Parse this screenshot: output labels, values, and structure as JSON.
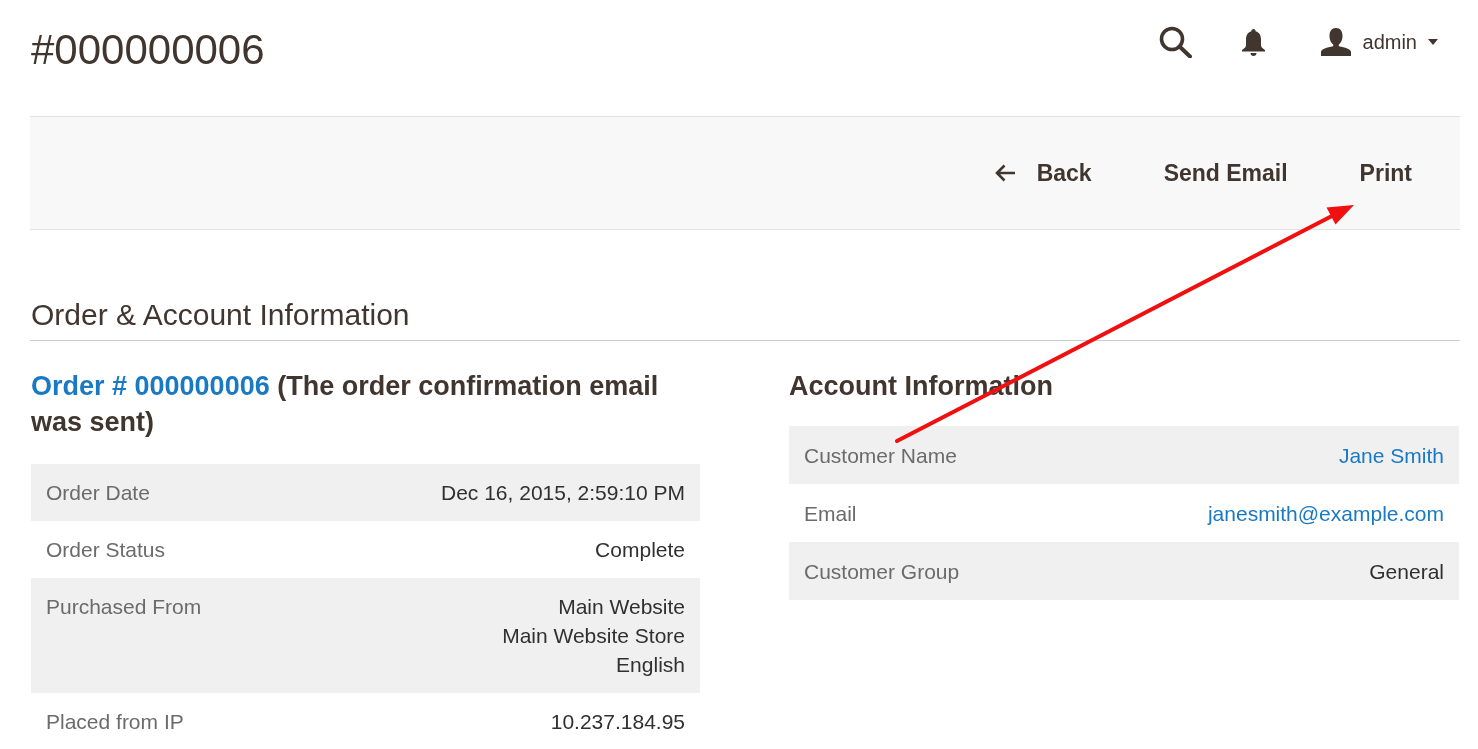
{
  "header": {
    "title": "#000000006",
    "user": "admin"
  },
  "actions": [
    {
      "label": "Back",
      "kind": "back"
    },
    {
      "label": "Send Email",
      "kind": "plain"
    },
    {
      "label": "Print",
      "kind": "plain"
    }
  ],
  "section_title": "Order & Account Information",
  "order": {
    "link": "Order # 000000006",
    "note": "(The order confirmation email was sent)",
    "rows": [
      {
        "label": "Order Date",
        "lines": [
          "Dec 16, 2015, 2:59:10 PM"
        ]
      },
      {
        "label": "Order Status",
        "lines": [
          "Complete"
        ]
      },
      {
        "label": "Purchased From",
        "lines": [
          "Main Website",
          "Main Website Store",
          "English"
        ]
      },
      {
        "label": "Placed from IP",
        "lines": [
          "10.237.184.95"
        ]
      }
    ]
  },
  "account": {
    "title": "Account Information",
    "rows": [
      {
        "label": "Customer Name",
        "value": "Jane Smith",
        "kind": "link"
      },
      {
        "label": "Email",
        "value": "janesmith@example.com",
        "kind": "link"
      },
      {
        "label": "Customer Group",
        "value": "General",
        "kind": "text"
      }
    ]
  }
}
